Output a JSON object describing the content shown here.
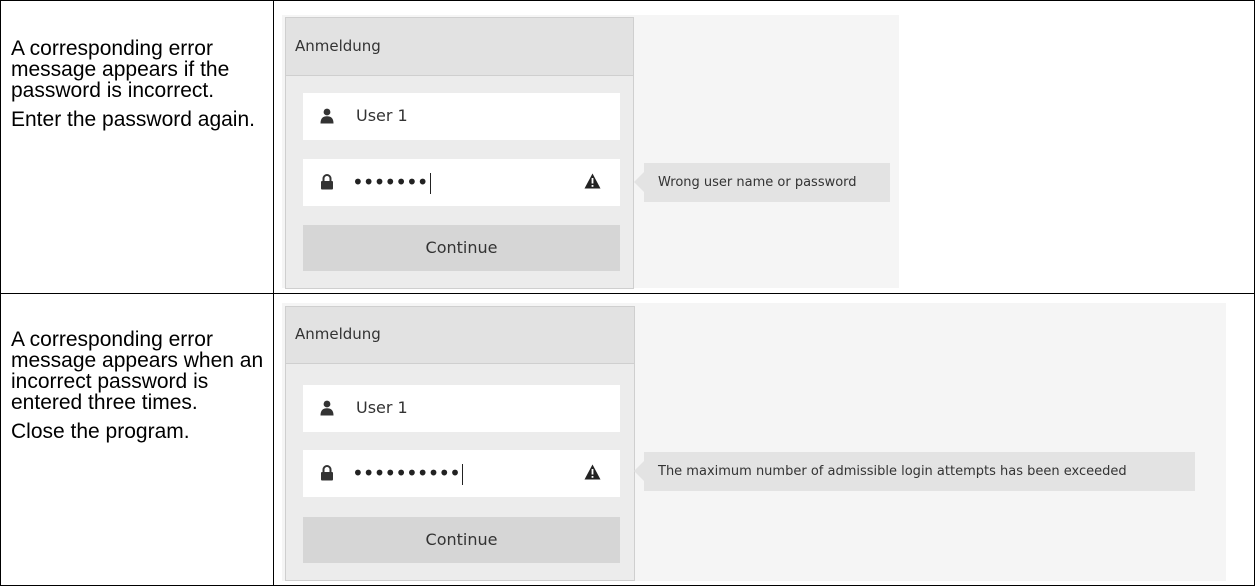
{
  "rows": [
    {
      "description": [
        "A corresponding error message appears if the password is incorrect.",
        "Enter the password again."
      ],
      "dialog": {
        "title": "Anmeldung",
        "username": "User 1",
        "password_mask": "•••••••",
        "continue_label": "Continue",
        "error_message": "Wrong user name or password"
      }
    },
    {
      "description": [
        "A corresponding error message appears when an incorrect password is entered three times.",
        "Close the program."
      ],
      "dialog": {
        "title": "Anmeldung",
        "username": "User 1",
        "password_mask": "••••••••••",
        "continue_label": "Continue",
        "error_message": "The maximum number of admissible login attempts has been exceeded"
      }
    }
  ],
  "icons": {
    "user": "user-icon",
    "password": "lock-icon",
    "warning": "warning-icon"
  }
}
